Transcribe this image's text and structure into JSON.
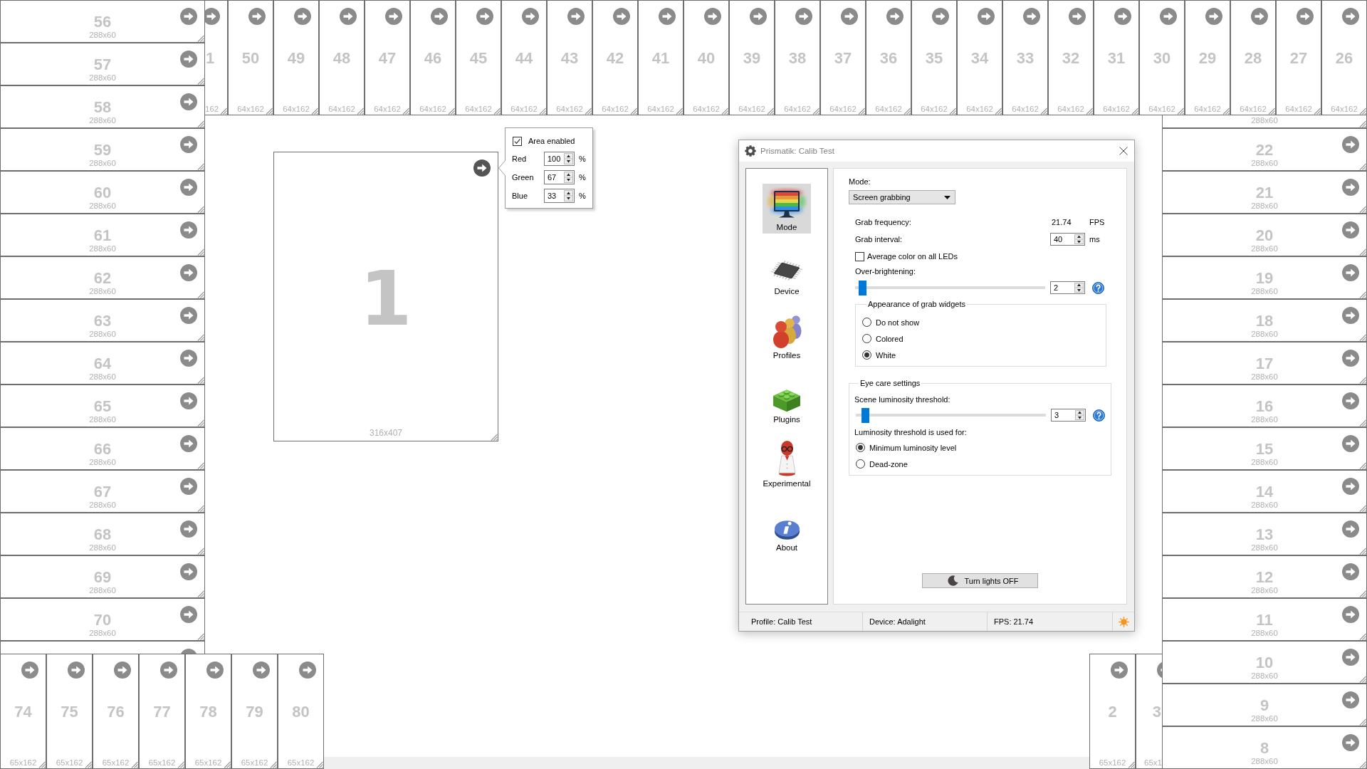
{
  "top_row": {
    "cut_widget": {
      "number": "1",
      "size": "162"
    },
    "widgets": [
      {
        "number": "50",
        "size": "64x162"
      },
      {
        "number": "49",
        "size": "64x162"
      },
      {
        "number": "48",
        "size": "64x162"
      },
      {
        "number": "47",
        "size": "64x162"
      },
      {
        "number": "46",
        "size": "64x162"
      },
      {
        "number": "45",
        "size": "64x162"
      },
      {
        "number": "44",
        "size": "64x162"
      },
      {
        "number": "43",
        "size": "64x162"
      },
      {
        "number": "42",
        "size": "64x162"
      },
      {
        "number": "41",
        "size": "64x162"
      },
      {
        "number": "40",
        "size": "64x162"
      },
      {
        "number": "39",
        "size": "64x162"
      },
      {
        "number": "38",
        "size": "64x162"
      },
      {
        "number": "37",
        "size": "64x162"
      },
      {
        "number": "36",
        "size": "64x162"
      },
      {
        "number": "35",
        "size": "64x162"
      },
      {
        "number": "34",
        "size": "64x162"
      },
      {
        "number": "33",
        "size": "64x162"
      },
      {
        "number": "32",
        "size": "64x162"
      },
      {
        "number": "31",
        "size": "64x162"
      },
      {
        "number": "30",
        "size": "64x162"
      },
      {
        "number": "29",
        "size": "64x162"
      },
      {
        "number": "28",
        "size": "64x162"
      },
      {
        "number": "27",
        "size": "64x162"
      },
      {
        "number": "26",
        "size": "64x162"
      }
    ]
  },
  "left_column": {
    "widgets": [
      {
        "number": "56",
        "size": "288x60"
      },
      {
        "number": "57",
        "size": "288x60"
      },
      {
        "number": "58",
        "size": "288x60"
      },
      {
        "number": "59",
        "size": "288x60"
      },
      {
        "number": "60",
        "size": "288x60"
      },
      {
        "number": "61",
        "size": "288x60"
      },
      {
        "number": "62",
        "size": "288x60"
      },
      {
        "number": "63",
        "size": "288x60"
      },
      {
        "number": "64",
        "size": "288x60"
      },
      {
        "number": "65",
        "size": "288x60"
      },
      {
        "number": "66",
        "size": "288x60"
      },
      {
        "number": "67",
        "size": "288x60"
      },
      {
        "number": "68",
        "size": "288x60"
      },
      {
        "number": "69",
        "size": "288x60"
      },
      {
        "number": "70",
        "size": "288x60"
      }
    ]
  },
  "right_column": {
    "cut_widget": {
      "size": "288x60"
    },
    "widgets": [
      {
        "number": "22",
        "size": "288x60"
      },
      {
        "number": "21",
        "size": "288x60"
      },
      {
        "number": "20",
        "size": "288x60"
      },
      {
        "number": "19",
        "size": "288x60"
      },
      {
        "number": "18",
        "size": "288x60"
      },
      {
        "number": "17",
        "size": "288x60"
      },
      {
        "number": "16",
        "size": "288x60"
      },
      {
        "number": "15",
        "size": "288x60"
      },
      {
        "number": "14",
        "size": "288x60"
      },
      {
        "number": "13",
        "size": "288x60"
      },
      {
        "number": "12",
        "size": "288x60"
      },
      {
        "number": "11",
        "size": "288x60"
      },
      {
        "number": "10",
        "size": "288x60"
      },
      {
        "number": "9",
        "size": "288x60"
      },
      {
        "number": "8",
        "size": "288x60"
      }
    ]
  },
  "bottom_row": {
    "widgets": [
      {
        "number": "74",
        "size": "65x162"
      },
      {
        "number": "75",
        "size": "65x162"
      },
      {
        "number": "76",
        "size": "65x162"
      },
      {
        "number": "77",
        "size": "65x162"
      },
      {
        "number": "78",
        "size": "65x162"
      },
      {
        "number": "79",
        "size": "65x162"
      },
      {
        "number": "80",
        "size": "65x162"
      }
    ]
  },
  "bottom_right": {
    "widgets": [
      {
        "number": "2",
        "size": "65x162"
      }
    ],
    "cut_widget": {
      "number": "3",
      "size": "65x1"
    }
  },
  "selected_widget": {
    "number": "1",
    "size": "316x407",
    "popup": {
      "area_enabled": {
        "label": "Area enabled",
        "checked": true
      },
      "channels": [
        {
          "label": "Red",
          "value": "100",
          "unit": "%"
        },
        {
          "label": "Green",
          "value": "67",
          "unit": "%"
        },
        {
          "label": "Blue",
          "value": "33",
          "unit": "%"
        }
      ]
    }
  },
  "dialog": {
    "title": "Prismatik: Calib Test",
    "nav": [
      {
        "kind": "mode",
        "label": "Mode",
        "selected": true
      },
      {
        "kind": "device",
        "label": "Device",
        "selected": false
      },
      {
        "kind": "profiles",
        "label": "Profiles",
        "selected": false
      },
      {
        "kind": "plugins",
        "label": "Plugins",
        "selected": false
      },
      {
        "kind": "experimental",
        "label": "Experimental",
        "selected": false
      },
      {
        "kind": "about",
        "label": "About",
        "selected": false
      }
    ],
    "mode": {
      "label": "Mode:",
      "value": "Screen grabbing"
    },
    "grab_frequency": {
      "label": "Grab frequency:",
      "value": "21.74",
      "unit": "FPS"
    },
    "grab_interval": {
      "label": "Grab interval:",
      "value": "40",
      "unit": "ms"
    },
    "average_color": {
      "label": "Average color on all LEDs",
      "checked": false
    },
    "over_brightening": {
      "label": "Over-brightening:",
      "level": 0.02,
      "value": "2"
    },
    "grab_widgets_group": {
      "title": "Appearance of grab widgets",
      "options": [
        {
          "label": "Do not show",
          "selected": false
        },
        {
          "label": "Colored",
          "selected": false
        },
        {
          "label": "White",
          "selected": true
        }
      ]
    },
    "eye_care": {
      "title": "Eye care settings",
      "threshold": {
        "label": "Scene luminosity threshold:",
        "level": 0.03,
        "value": "3"
      },
      "used_for_label": "Luminosity threshold is used for:",
      "options": [
        {
          "label": "Minimum luminosity level",
          "selected": true
        },
        {
          "label": "Dead-zone",
          "selected": false
        }
      ]
    },
    "lights_button": {
      "label": "Turn lights OFF"
    },
    "status_bar": {
      "profile": "Profile: Calib Test",
      "device": "Device: Adalight",
      "fps": "FPS: 21.74"
    }
  }
}
